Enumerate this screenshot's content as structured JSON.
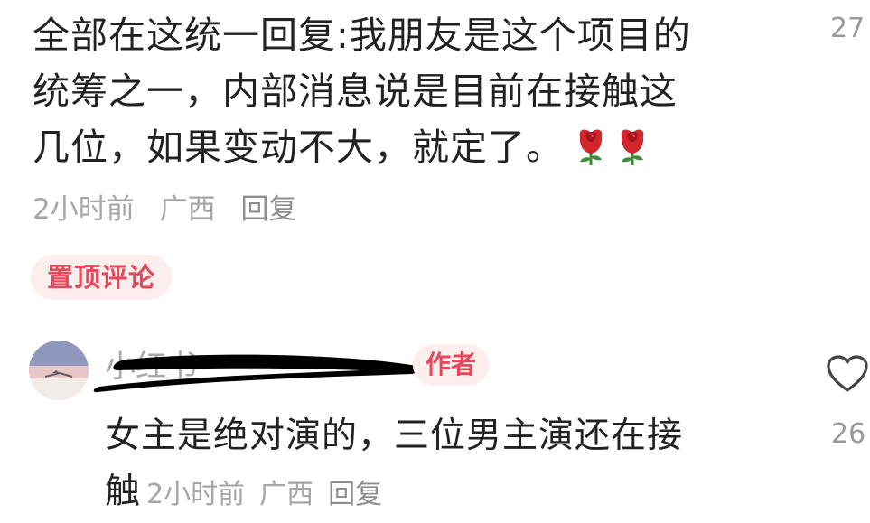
{
  "top_comment": {
    "lines": [
      "全部在这统一回复:我朋友是这个项目的",
      "统筹之一，内部消息说是目前在接触这",
      "几位，如果变动不大，就定了。"
    ],
    "emoji": [
      "rose-emoji",
      "rose-emoji"
    ],
    "likes": "27",
    "time": "2小时前",
    "location": "广西",
    "reply_label": "回复",
    "pinned_label": "置顶评论"
  },
  "reply_comment": {
    "username_visible": "小红书",
    "author_badge": "作者",
    "lines": [
      "女主是绝对演的，三位男主演还在接",
      "触"
    ],
    "time": "2小时前",
    "location": "广西",
    "reply_label": "回复",
    "likes": "26"
  },
  "icons": {
    "like": "heart-outline-icon"
  },
  "colors": {
    "accent": "#e8465a",
    "badge_bg": "#fdeeee",
    "meta_text": "#a6a6a6"
  }
}
